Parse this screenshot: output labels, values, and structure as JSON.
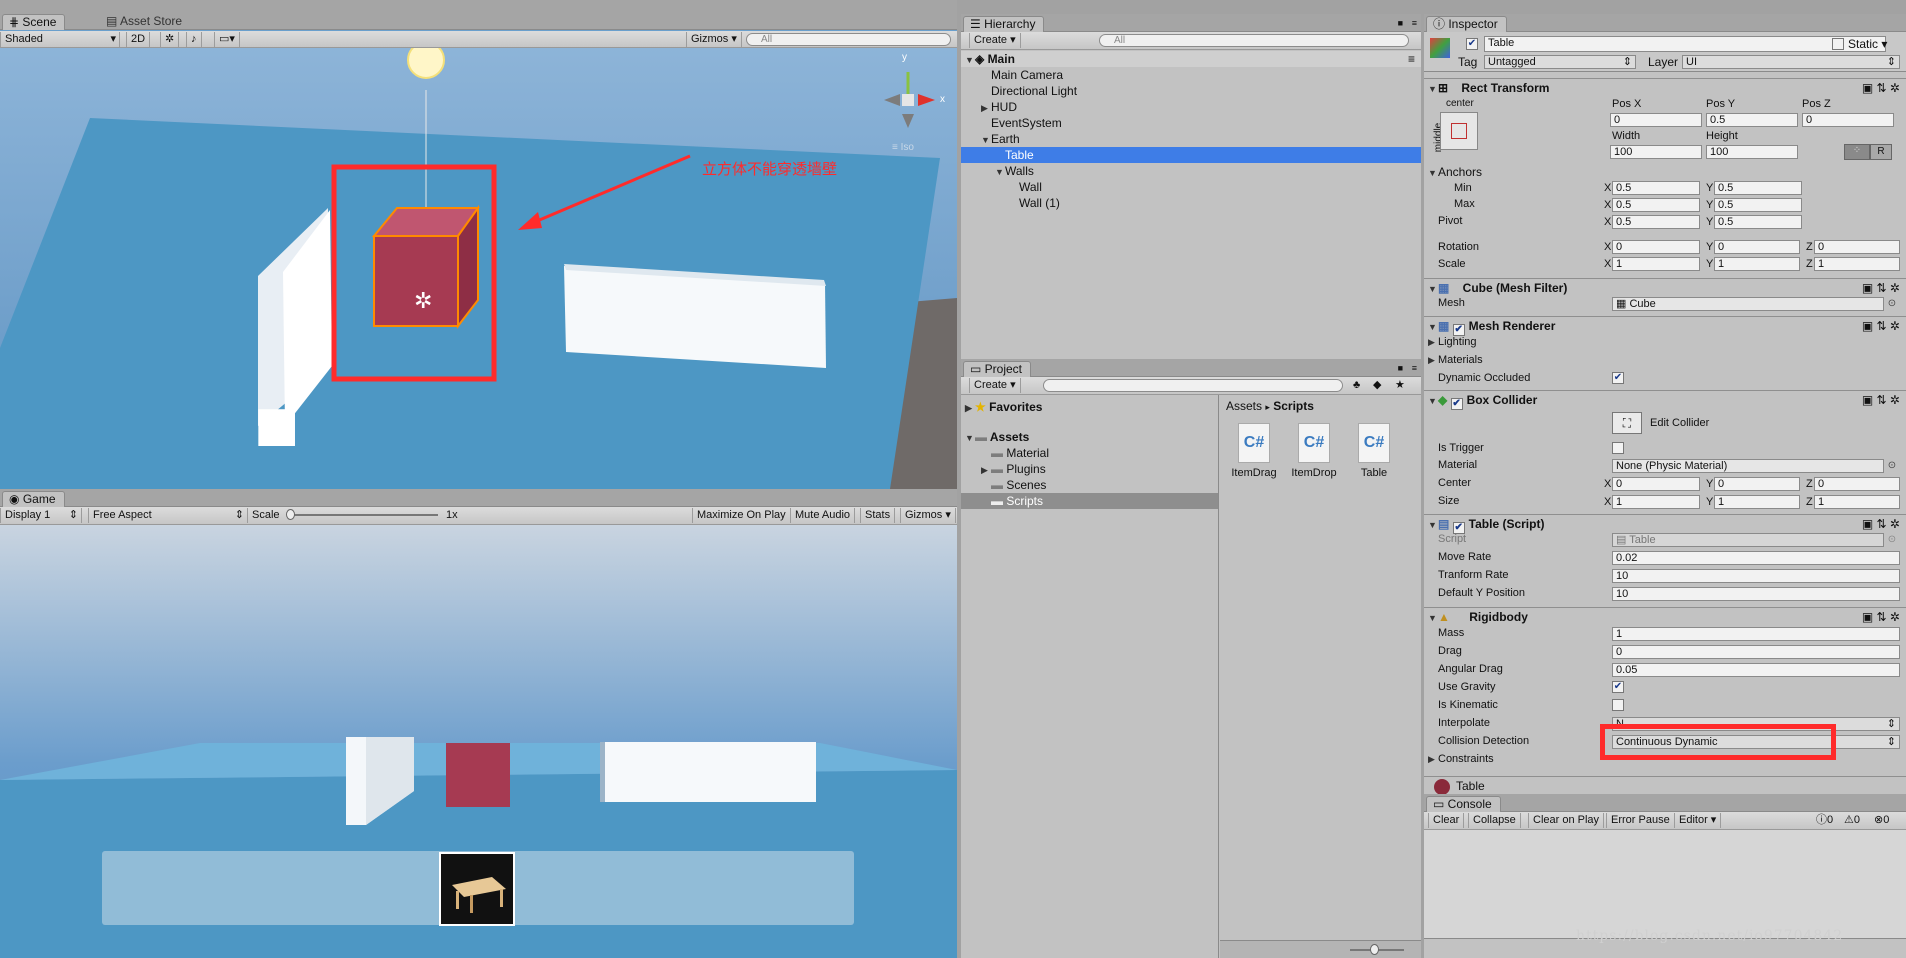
{
  "scene": {
    "tabs": [
      "Scene",
      "Asset Store"
    ],
    "shading": "Shaded",
    "toggle_2d": "2D",
    "gizmos_label": "Gizmos",
    "search_placeholder": "All",
    "gizmo_axis_y": "y",
    "gizmo_axis_x": "x",
    "gizmo_label": "Iso",
    "annotation_text": "立方体不能穿透墙壁",
    "sky_color": "#6a9fcc",
    "floor_color": "#4d97c4",
    "cube_color": "#a63a52",
    "highlight_color": "#ff2b2b"
  },
  "game": {
    "tab": "Game",
    "display": "Display 1",
    "aspect": "Free Aspect",
    "scale_label": "Scale",
    "scale_value": "1x",
    "maximize": "Maximize On Play",
    "mute": "Mute Audio",
    "stats": "Stats",
    "gizmos": "Gizmos"
  },
  "hierarchy": {
    "tab": "Hierarchy",
    "create": "Create",
    "search_placeholder": "All",
    "scene_name": "Main",
    "items": [
      {
        "label": "Main Camera"
      },
      {
        "label": "Directional Light"
      },
      {
        "label": "HUD"
      },
      {
        "label": "EventSystem"
      },
      {
        "label": "Earth"
      },
      {
        "label": "Table",
        "selected": true
      },
      {
        "label": "Walls"
      },
      {
        "label": "Wall"
      },
      {
        "label": "Wall (1)"
      }
    ]
  },
  "project": {
    "tab": "Project",
    "create": "Create",
    "favorites": "Favorites",
    "assets": "Assets",
    "folders": [
      "Material",
      "Plugins",
      "Scenes",
      "Scripts"
    ],
    "breadcrumb_root": "Assets",
    "breadcrumb_sep": "▸",
    "breadcrumb_current": "Scripts",
    "files": [
      {
        "name": "ItemDrag",
        "glyph": "C#"
      },
      {
        "name": "ItemDrop",
        "glyph": "C#"
      },
      {
        "name": "Table",
        "glyph": "C#"
      }
    ]
  },
  "inspector": {
    "tab": "Inspector",
    "object_name": "Table",
    "static_label": "Static",
    "tag_label": "Tag",
    "tag_value": "Untagged",
    "layer_label": "Layer",
    "layer_value": "UI",
    "rect": {
      "title": "Rect Transform",
      "anchor_h": "center",
      "anchor_v": "middle",
      "posx_label": "Pos X",
      "posy_label": "Pos Y",
      "posz_label": "Pos Z",
      "posx": "0",
      "posy": "0.5",
      "posz": "0",
      "width_label": "Width",
      "height_label": "Height",
      "width": "100",
      "height": "100",
      "r_button": "R",
      "anchors_label": "Anchors",
      "min_label": "Min",
      "max_label": "Max",
      "min_x": "0.5",
      "min_y": "0.5",
      "max_x": "0.5",
      "max_y": "0.5",
      "pivot_label": "Pivot",
      "pivot_x": "0.5",
      "pivot_y": "0.5",
      "rotation_label": "Rotation",
      "rot_x": "0",
      "rot_y": "0",
      "rot_z": "0",
      "scale_label": "Scale",
      "scale_x": "1",
      "scale_y": "1",
      "scale_z": "1",
      "axis_x": "X",
      "axis_y": "Y",
      "axis_z": "Z"
    },
    "mesh_filter": {
      "title": "Cube (Mesh Filter)",
      "mesh_label": "Mesh",
      "mesh_value": "Cube"
    },
    "mesh_renderer": {
      "title": "Mesh Renderer",
      "lighting": "Lighting",
      "materials": "Materials",
      "dynamic_occluded": "Dynamic Occluded"
    },
    "box_collider": {
      "title": "Box Collider",
      "edit_collider": "Edit Collider",
      "is_trigger": "Is Trigger",
      "material_label": "Material",
      "material_value": "None (Physic Material)",
      "center_label": "Center",
      "center_x": "0",
      "center_y": "0",
      "center_z": "0",
      "size_label": "Size",
      "size_x": "1",
      "size_y": "1",
      "size_z": "1"
    },
    "script": {
      "title": "Table (Script)",
      "script_label": "Script",
      "script_value": "Table",
      "move_rate_label": "Move Rate",
      "move_rate": "0.02",
      "tranform_rate_label": "Tranform Rate",
      "tranform_rate": "10",
      "default_y_label": "Default Y Position",
      "default_y": "10"
    },
    "rigidbody": {
      "title": "Rigidbody",
      "mass_label": "Mass",
      "mass": "1",
      "drag_label": "Drag",
      "drag": "0",
      "angular_drag_label": "Angular Drag",
      "angular_drag": "0.05",
      "use_gravity": "Use Gravity",
      "is_kinematic": "Is Kinematic",
      "interpolate_label": "Interpolate",
      "interpolate_value": "N...",
      "collision_label": "Collision Detection",
      "collision_value": "Continuous Dynamic",
      "constraints": "Constraints"
    },
    "material_preview": "Table"
  },
  "console": {
    "tab": "Console",
    "clear": "Clear",
    "collapse": "Collapse",
    "clear_on_play": "Clear on Play",
    "error_pause": "Error Pause",
    "editor": "Editor",
    "count_info": "0",
    "count_warn": "0",
    "count_err": "0"
  },
  "watermark": "https://blog.csdn.net/io97704842"
}
